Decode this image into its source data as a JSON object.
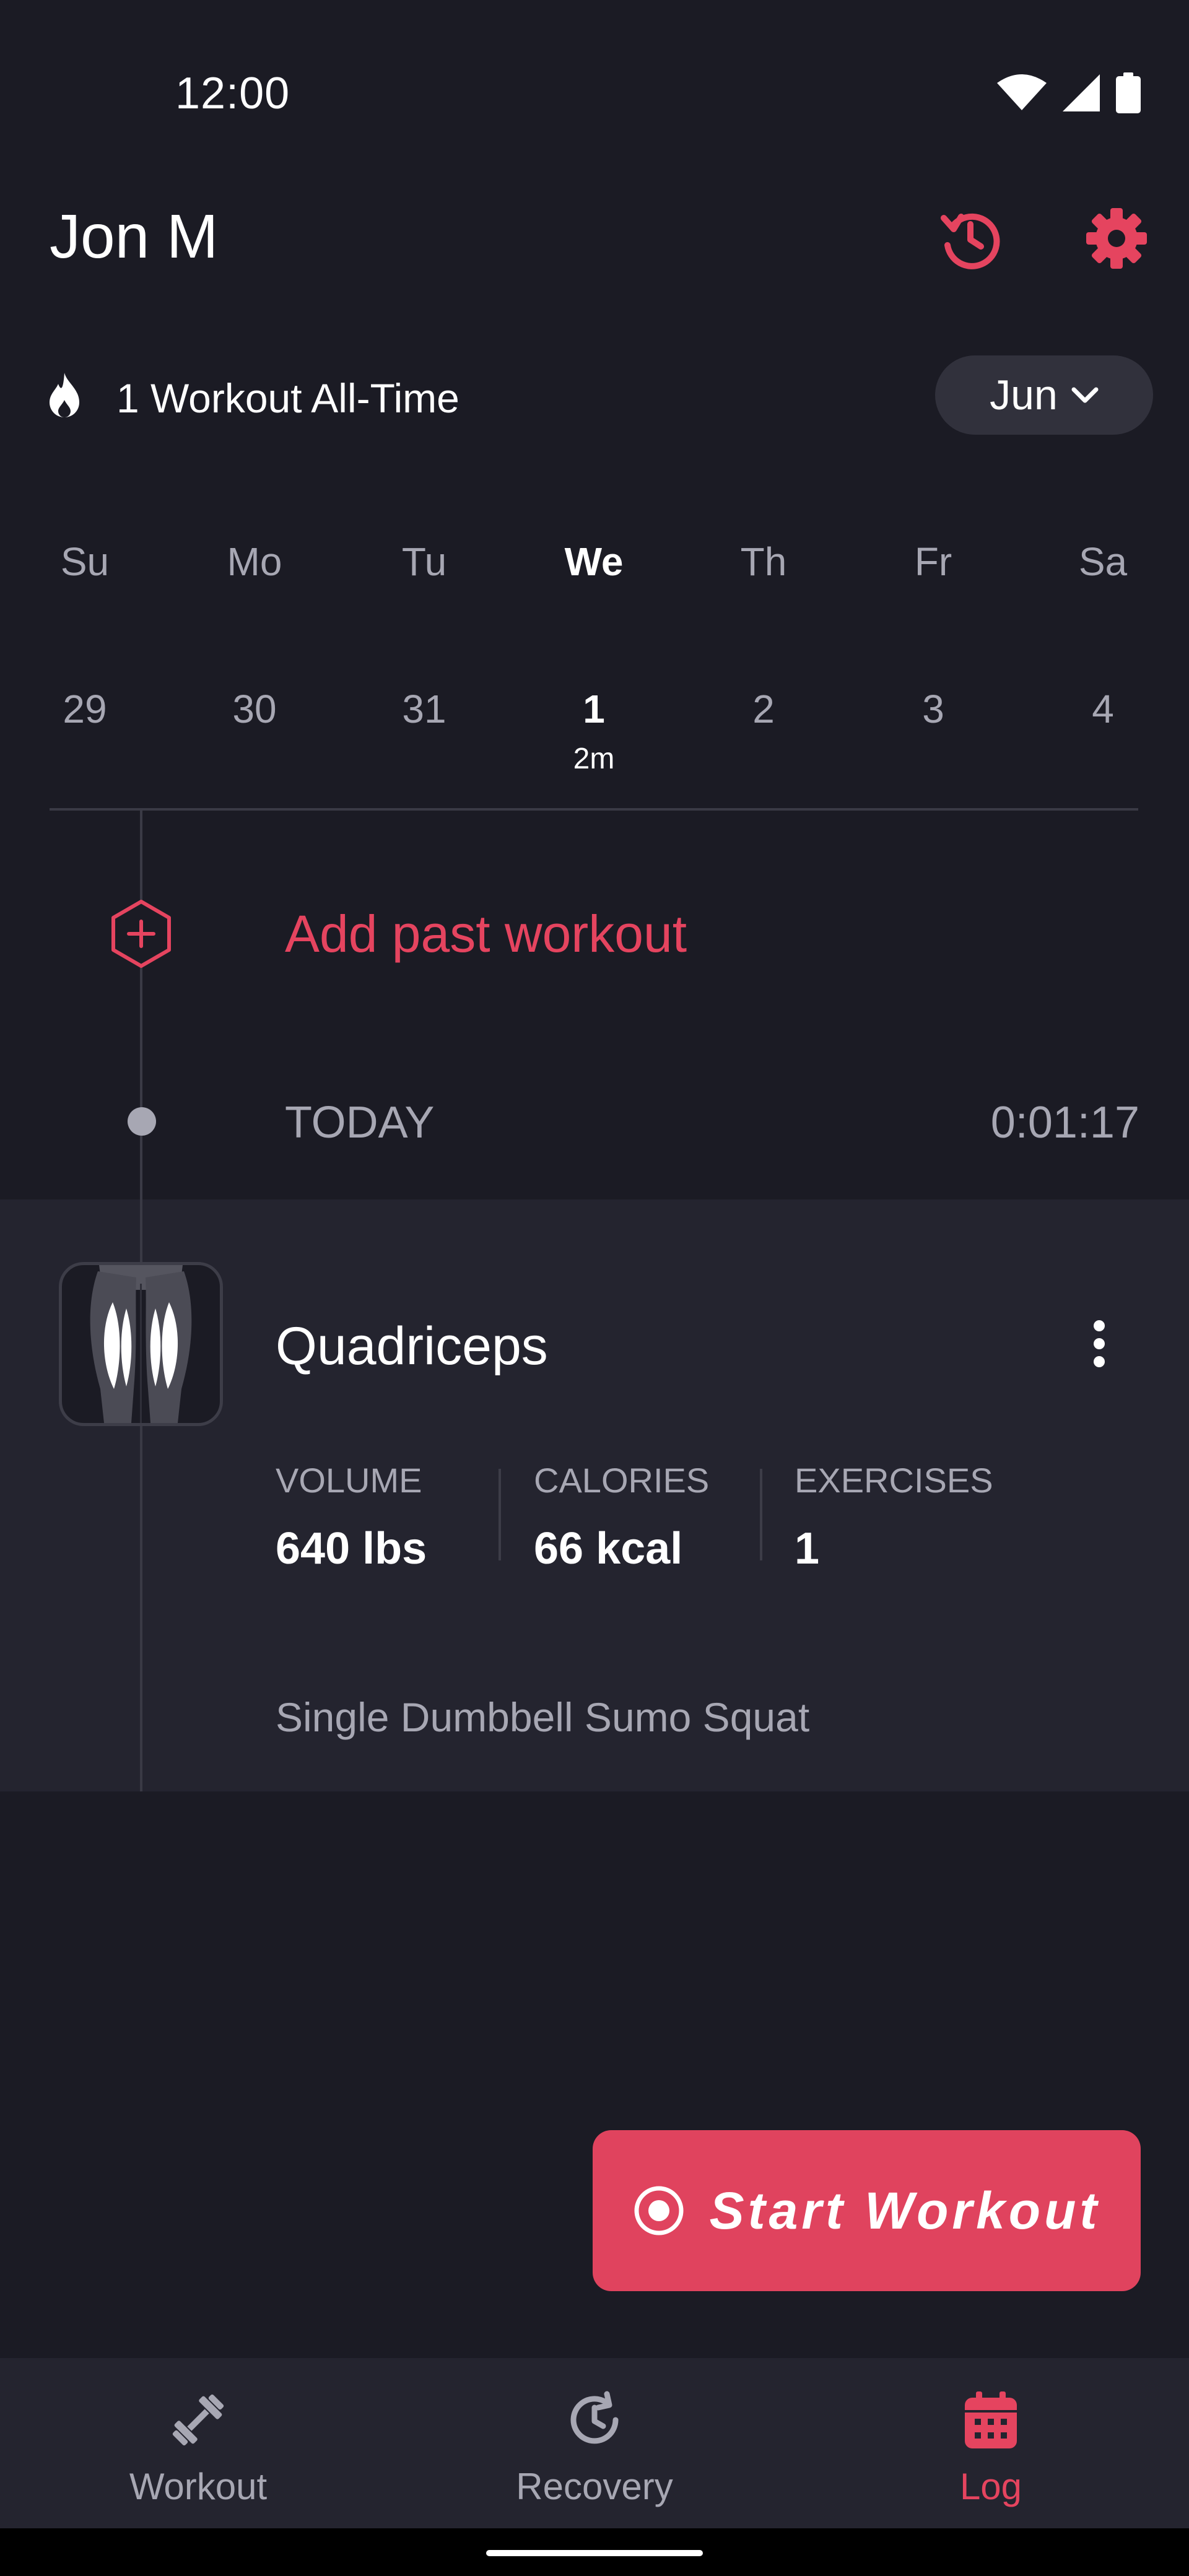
{
  "status_bar": {
    "time": "12:00"
  },
  "header": {
    "title": "Jon M"
  },
  "streak": {
    "text": "1 Workout All-Time"
  },
  "month_selector": {
    "label": "Jun"
  },
  "calendar": {
    "days": [
      {
        "name": "Su",
        "date": "29",
        "sub": ""
      },
      {
        "name": "Mo",
        "date": "30",
        "sub": ""
      },
      {
        "name": "Tu",
        "date": "31",
        "sub": ""
      },
      {
        "name": "We",
        "date": "1",
        "sub": "2m"
      },
      {
        "name": "Th",
        "date": "2",
        "sub": ""
      },
      {
        "name": "Fr",
        "date": "3",
        "sub": ""
      },
      {
        "name": "Sa",
        "date": "4",
        "sub": ""
      }
    ],
    "selected_index": 3
  },
  "add_past": {
    "label": "Add past workout"
  },
  "today": {
    "label": "TODAY",
    "timer": "0:01:17"
  },
  "workout": {
    "title": "Quadriceps",
    "stats": [
      {
        "label": "VOLUME",
        "value": "640 lbs"
      },
      {
        "label": "CALORIES",
        "value": "66 kcal"
      },
      {
        "label": "EXERCISES",
        "value": "1"
      }
    ],
    "exercise": "Single Dumbbell Sumo Squat"
  },
  "start_button": {
    "label": "Start Workout"
  },
  "nav": {
    "items": [
      {
        "label": "Workout",
        "icon": "dumbbell-icon"
      },
      {
        "label": "Recovery",
        "icon": "recovery-icon"
      },
      {
        "label": "Log",
        "icon": "calendar-icon"
      }
    ],
    "active": "Log"
  },
  "colors": {
    "accent": "#e5445f",
    "background": "#1b1b24",
    "card": "#24242f",
    "muted": "#a7a7b3"
  }
}
